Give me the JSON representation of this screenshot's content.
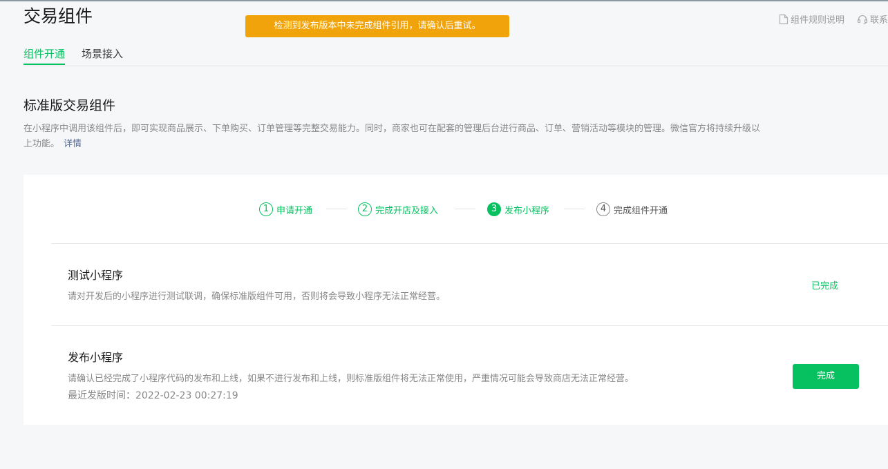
{
  "header": {
    "title": "交易组件",
    "toast": "检测到发布版本中未完成组件引用，请确认后重试。",
    "links": [
      {
        "label": "组件规则说明",
        "icon": "document-icon"
      },
      {
        "label": "联系",
        "icon": "headset-icon"
      }
    ]
  },
  "tabs": [
    {
      "label": "组件开通",
      "active": true
    },
    {
      "label": "场景接入",
      "active": false
    }
  ],
  "section": {
    "title": "标准版交易组件",
    "description": "在小程序中调用该组件后，即可实现商品展示、下单购买、订单管理等完整交易能力。同时，商家也可在配套的管理后台进行商品、订单、营销活动等模块的管理。微信官方将持续升级以上功能。",
    "detail_link": "详情"
  },
  "steps": [
    {
      "num": "1",
      "label": "申请开通",
      "state": "done"
    },
    {
      "num": "2",
      "label": "完成开店及接入",
      "state": "done"
    },
    {
      "num": "3",
      "label": "发布小程序",
      "state": "current"
    },
    {
      "num": "4",
      "label": "完成组件开通",
      "state": "todo"
    }
  ],
  "tasks": {
    "test": {
      "title": "测试小程序",
      "desc": "请对开发后的小程序进行测试联调，确保标准版组件可用，否则将会导致小程序无法正常经营。",
      "status": "已完成"
    },
    "publish": {
      "title": "发布小程序",
      "desc": "请确认已经完成了小程序代码的发布和上线，如果不进行发布和上线，则标准版组件将无法正常使用，严重情况可能会导致商店无法正常经营。",
      "time": "最近发版时间：2022-02-23 00:27:19",
      "button": "完成"
    }
  },
  "colors": {
    "accent": "#07c160",
    "warning": "#f0a30a",
    "link": "#576b95"
  }
}
